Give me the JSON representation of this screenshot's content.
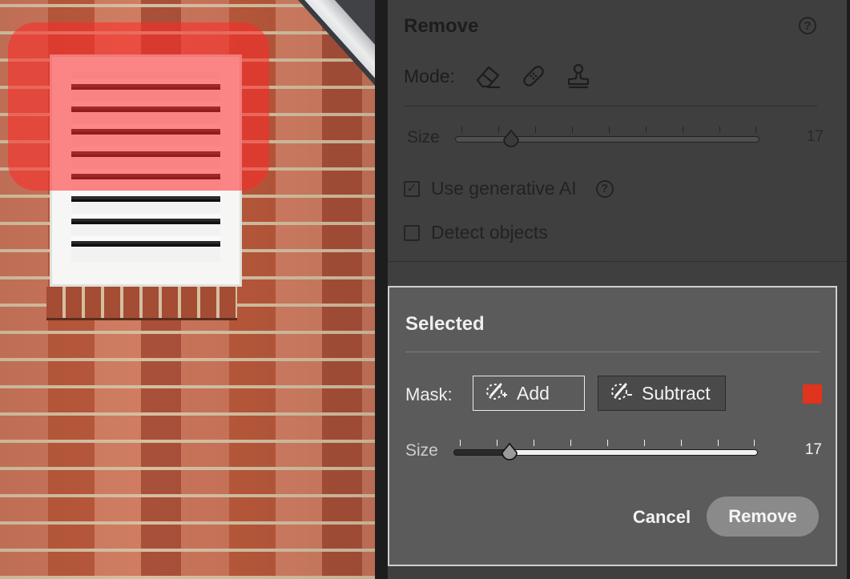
{
  "canvas": {
    "photo_icon": "brick-wall-with-vent-photo",
    "mask_color": "#ff2828"
  },
  "remove_panel": {
    "title": "Remove",
    "help_icon": "?",
    "mode_label": "Mode:",
    "mode_icons": [
      "eraser-icon",
      "bandage-icon",
      "clone-stamp-icon"
    ],
    "size_label": "Size",
    "size_value": "17",
    "size_level_percent": 18,
    "generative_ai_label": "Use generative AI",
    "generative_ai_checked": true,
    "generative_ai_help": "?",
    "detect_objects_label": "Detect objects",
    "detect_objects_checked": false
  },
  "selected_panel": {
    "title": "Selected",
    "mask_label": "Mask:",
    "add_label": "Add",
    "subtract_label": "Subtract",
    "mask_swatch_color": "#e0341d",
    "size_label": "Size",
    "size_value": "17",
    "size_level_percent": 18,
    "cancel_label": "Cancel",
    "remove_label": "Remove"
  }
}
